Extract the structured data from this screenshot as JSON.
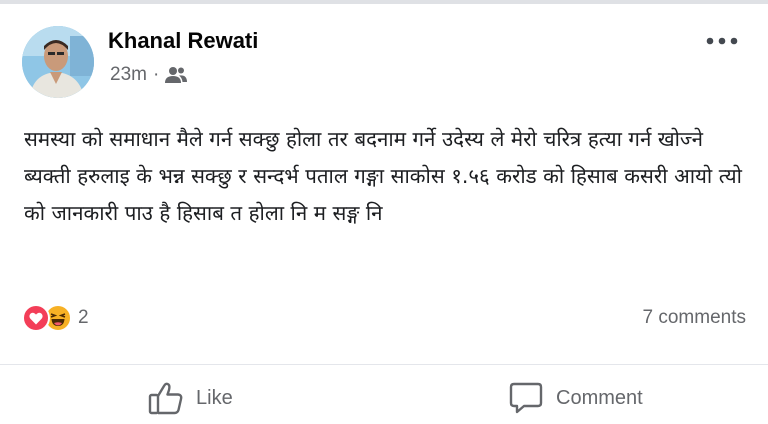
{
  "post": {
    "author_name": "Khanal Rewati",
    "timestamp": "23m",
    "separator": "·",
    "audience_icon": "friends-icon",
    "more_icon": "more-options-icon",
    "text": "समस्या को समाधान  मैले गर्न सक्छु होला तर बदनाम गर्ने उदेस्य ले मेरो चरित्र हत्या गर्न खोज्ने ब्यक्ती हरुलाइ के भन्न सक्छु र सन्दर्भ पताल गङ्गा साकोस १.५६ करोड को हिसाब कसरी आयो त्यो को जानकारी पाउ है हिसाब त होला नि म सङ्ग नि"
  },
  "reactions": {
    "types": [
      "love",
      "haha"
    ],
    "count": "2",
    "colors": {
      "love": "#f33e58",
      "haha": "#f7b125"
    }
  },
  "comments": {
    "count_label": "7 comments"
  },
  "actions": {
    "like_label": "Like",
    "like_icon": "thumbs-up-icon",
    "comment_label": "Comment",
    "comment_icon": "comment-bubble-icon"
  },
  "colors": {
    "text_primary": "#050505",
    "text_secondary": "#65676b",
    "divider": "#e4e6eb"
  }
}
